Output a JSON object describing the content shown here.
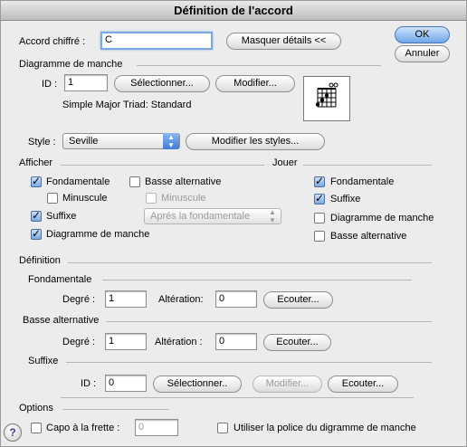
{
  "window": {
    "title": "Définition de l'accord"
  },
  "chord": {
    "label": "Accord chiffré :",
    "value": "C",
    "hide_details_label": "Masquer détails <<",
    "ok_label": "OK",
    "cancel_label": "Annuler"
  },
  "diagram": {
    "section_label": "Diagramme de manche",
    "id_label": "ID :",
    "id_value": "1",
    "select_label": "Sélectionner...",
    "modify_label": "Modifier...",
    "description": "Simple Major Triad:  Standard"
  },
  "style": {
    "label": "Style :",
    "value": "Seville",
    "modify_styles_label": "Modifier les styles..."
  },
  "show": {
    "section_label": "Afficher",
    "fundamental": "Fondamentale",
    "lowercase": "Minuscule",
    "suffix": "Suffixe",
    "fretboard_diagram": "Diagramme de manche",
    "alt_bass": "Basse alternative",
    "alt_lowercase": "Minuscule",
    "position_value": "Aprés la fondamentale"
  },
  "play": {
    "section_label": "Jouer",
    "fundamental": "Fondamentale",
    "suffix": "Suffixe",
    "fretboard_diagram": "Diagramme de manche",
    "alt_bass": "Basse alternative"
  },
  "definition": {
    "section_label": "Définition",
    "fundamental_label": "Fondamentale",
    "degree_label": "Degré :",
    "degree_value": "1",
    "alteration_label": "Altération:",
    "alteration_value": "0",
    "listen_label": "Ecouter...",
    "bass_label": "Basse alternative",
    "bass_degree_label": "Degré :",
    "bass_degree_value": "1",
    "bass_alteration_label": "Altération :",
    "bass_alteration_value": "0",
    "bass_listen_label": "Ecouter...",
    "suffix_label": "Suffixe",
    "suffix_id_label": "ID :",
    "suffix_id_value": "0",
    "suffix_select_label": "Sélectionner..",
    "suffix_modify_label": "Modifier...",
    "suffix_listen_label": "Ecouter..."
  },
  "options": {
    "section_label": "Options",
    "capo_label": "Capo à la frette :",
    "capo_value": "0",
    "use_font_label": "Utiliser la police du digramme de manche"
  },
  "colors": {
    "accent": "#6fa6ea"
  }
}
